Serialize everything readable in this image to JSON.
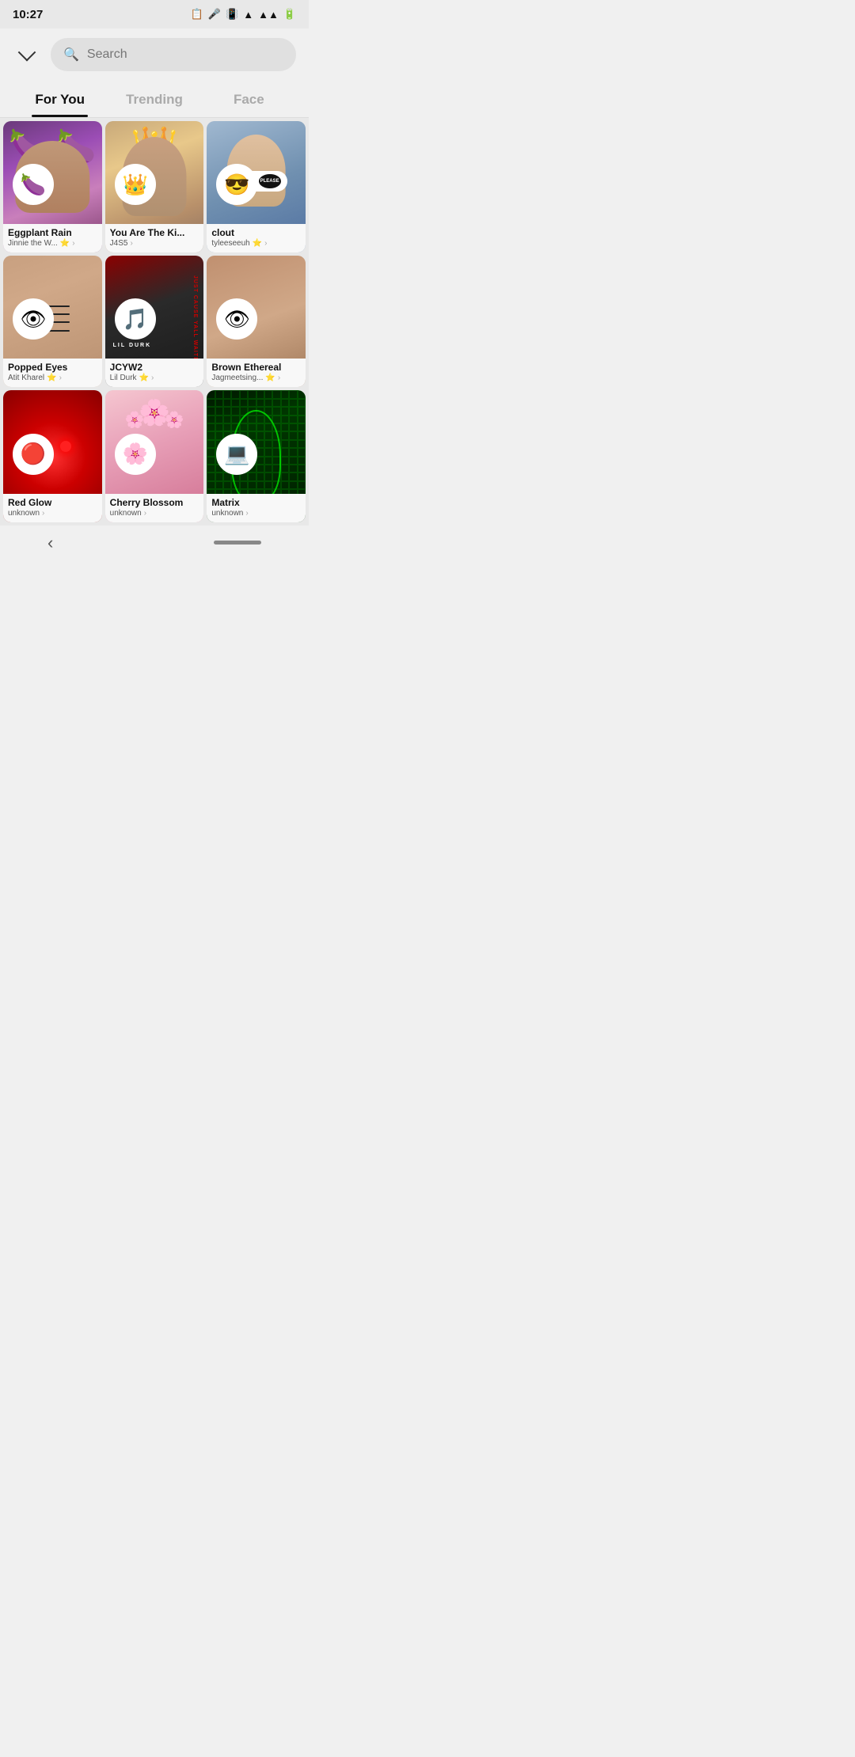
{
  "statusBar": {
    "time": "10:27",
    "icons": [
      "📋",
      "🎤"
    ]
  },
  "header": {
    "backLabel": "back",
    "searchPlaceholder": "Search"
  },
  "tabs": [
    {
      "id": "for-you",
      "label": "For You",
      "active": true
    },
    {
      "id": "trending",
      "label": "Trending",
      "active": false
    },
    {
      "id": "face",
      "label": "Face",
      "active": false
    }
  ],
  "items": [
    {
      "id": "eggplant-rain",
      "title": "Eggplant Rain",
      "author": "Jinnie the W...",
      "avatar": "🍆",
      "imgClass": "img-eggplant",
      "hasVerified": true
    },
    {
      "id": "you-are-the-king",
      "title": "You Are The Ki...",
      "author": "J4S5",
      "avatar": "👑",
      "imgClass": "img-king",
      "hasVerified": false
    },
    {
      "id": "clout",
      "title": "clout",
      "author": "tyleeseeuh",
      "avatar": "😎",
      "imgClass": "img-clout",
      "hasVerified": true
    },
    {
      "id": "popped-eyes",
      "title": "Popped Eyes",
      "author": "Atit Kharel",
      "avatar": "👁",
      "imgClass": "img-popped",
      "hasVerified": true
    },
    {
      "id": "jcyw2",
      "title": "JCYW2",
      "author": "Lil Durk",
      "avatar": "🎵",
      "imgClass": "img-jcyw2",
      "hasVerified": true
    },
    {
      "id": "brown-ethereal",
      "title": "Brown Ethereal",
      "author": "Jagmeetsing...",
      "avatar": "👁",
      "imgClass": "img-brown",
      "hasVerified": true
    },
    {
      "id": "red-glow",
      "title": "Red Glow",
      "author": "unknown",
      "avatar": "🔴",
      "imgClass": "img-red",
      "hasVerified": false
    },
    {
      "id": "cherry-blossom",
      "title": "Cherry Blossom",
      "author": "unknown",
      "avatar": "🌸",
      "imgClass": "img-cherry",
      "hasVerified": false
    },
    {
      "id": "matrix",
      "title": "Matrix",
      "author": "unknown",
      "avatar": "💻",
      "imgClass": "img-matrix",
      "hasVerified": false
    }
  ],
  "bottomNav": {
    "backLabel": "‹"
  }
}
